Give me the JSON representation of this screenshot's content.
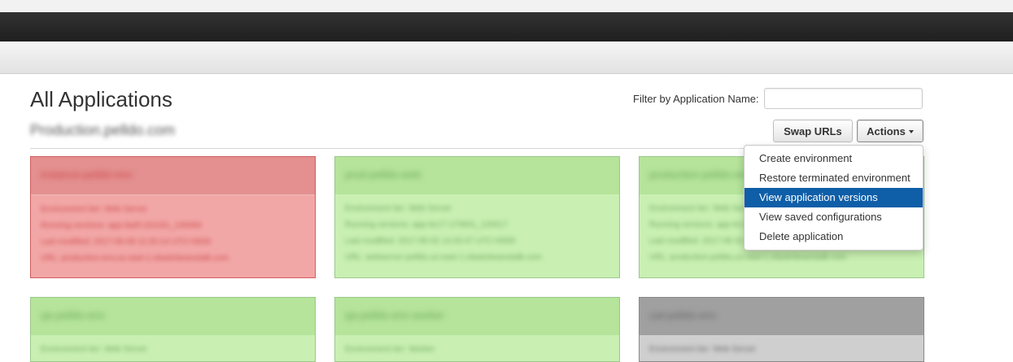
{
  "page": {
    "title": "All Applications",
    "subtitle": "Production.pelldo.com"
  },
  "filter": {
    "label": "Filter by Application Name:",
    "value": ""
  },
  "buttons": {
    "swap_urls": "Swap URLs",
    "actions": "Actions"
  },
  "actions_menu": {
    "items": [
      {
        "label": "Create environment"
      },
      {
        "label": "Restore terminated environment"
      },
      {
        "label": "View application versions",
        "active": true
      },
      {
        "label": "View saved configurations"
      },
      {
        "label": "Delete application"
      }
    ]
  },
  "status_colors": {
    "red": "#f2a7a7",
    "green": "#c9f0b2",
    "gray": "#cfcfcf",
    "menu_highlight": "#0f5ea8"
  },
  "environments": [
    {
      "status": "red",
      "name": "instance-pelldo-env",
      "lines": [
        "Environment tier: Web Server",
        "Running versions: app-6a0f-161031_100000",
        "Last modified: 2017-06-09 12:20:14 UTC+0000",
        "URL: production-env.us-east-1.elasticbeanstalk.com"
      ]
    },
    {
      "status": "green",
      "name": "prod-pelldo-web",
      "lines": [
        "Environment tier: Web Server",
        "Running versions: app-6c17-170601_120017",
        "Last modified: 2017-06-02 14:20:47 UTC+0000",
        "URL: webserver-pelldo.us-east-1.elasticbeanstalk.com"
      ]
    },
    {
      "status": "green",
      "name": "production-pelldo-env",
      "lines": [
        "Environment tier: Web Server",
        "Running versions: app-6c17-170601_120017",
        "Last modified: 2017-06-02 14:20:47 UTC+0000",
        "URL: production-pelldo.us-east-1.elasticbeanstalk.com"
      ]
    },
    {
      "status": "green",
      "name": "qa-pelldo-env",
      "lines": [
        "Environment tier: Web Server"
      ]
    },
    {
      "status": "green",
      "name": "qa-pelldo-env-worker",
      "lines": [
        "Environment tier: Worker"
      ]
    },
    {
      "status": "gray",
      "name": "uat-pelldo-env",
      "lines": [
        "Environment tier: Web Server"
      ]
    }
  ]
}
